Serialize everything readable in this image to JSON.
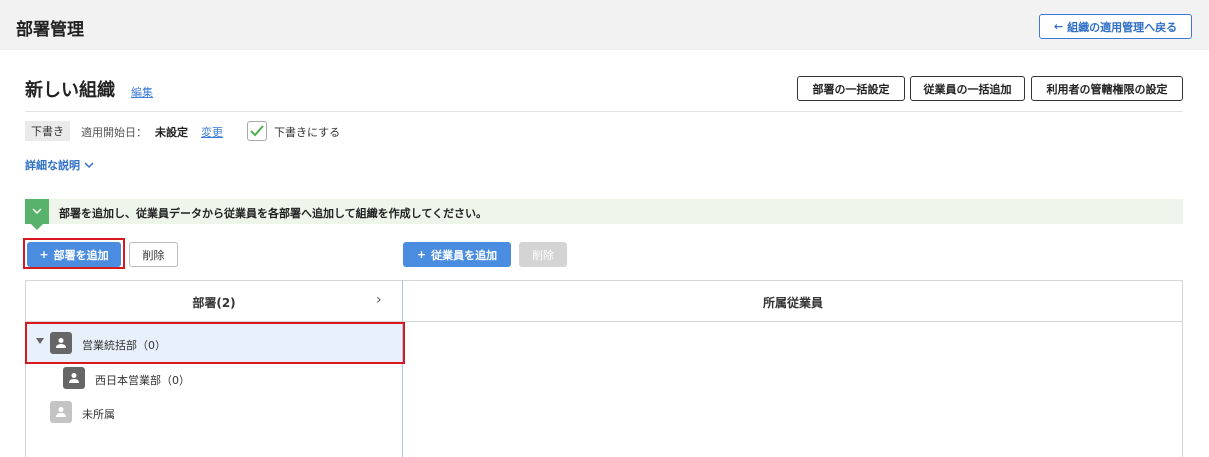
{
  "header": {
    "title": "部署管理",
    "back_label": "組織の適用管理へ戻る"
  },
  "org": {
    "name": "新しい組織",
    "edit_label": "編集",
    "bulk_dept_label": "部署の一括設定",
    "bulk_emp_label": "従業員の一括追加",
    "perm_label": "利用者の管轄権限の設定"
  },
  "status": {
    "draft_badge": "下書き",
    "start_label": "適用開始日：",
    "start_value": "未設定",
    "change_label": "変更",
    "draft_check_label": "下書きにする",
    "draft_checked": true
  },
  "detail_label": "詳細な説明",
  "info": {
    "message": "部署を追加し、従業員データから従業員を各部署へ追加して組織を作成してください。"
  },
  "toolbar": {
    "add_dept_label": "部署を追加",
    "delete_dept_label": "削除",
    "add_emp_label": "従業員を追加",
    "delete_emp_label": "削除"
  },
  "table": {
    "dept_header": "部署(2)",
    "emp_header": "所属従業員"
  },
  "tree": [
    {
      "label": "営業統括部（0）",
      "selected": true,
      "expanded": true,
      "icon": "person-icon"
    },
    {
      "label": "西日本営業部（0）",
      "selected": false,
      "icon": "person-icon"
    },
    {
      "label": "未所属",
      "selected": false,
      "icon": "person-icon"
    }
  ],
  "colors": {
    "accent": "#4a8de0",
    "link": "#3d7bd2",
    "highlight_border": "#d7191f",
    "info_green": "#58b26b",
    "selected_row": "#e8f0fb"
  }
}
